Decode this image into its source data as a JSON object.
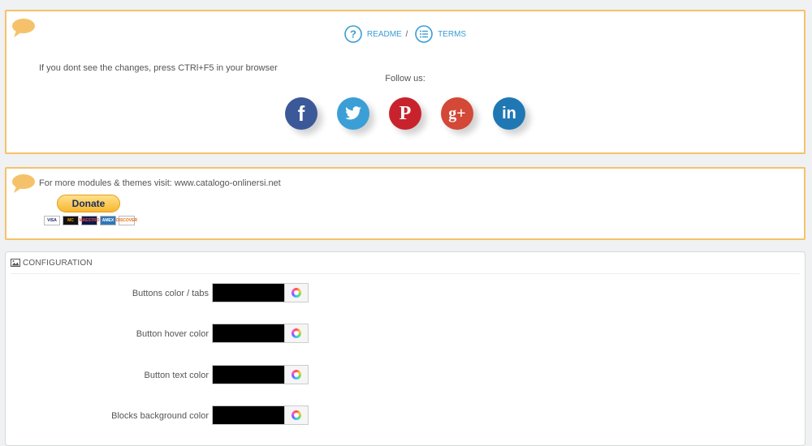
{
  "header_links": {
    "readme": "README",
    "separator": "/",
    "terms": "TERMS"
  },
  "notice": {
    "refresh_text": "If you dont see the changes, press CTRl+F5 in your browser",
    "follow_text": "Follow us:"
  },
  "social": [
    {
      "icon": "facebook-icon",
      "glyph": "f",
      "color": "#3b5998"
    },
    {
      "icon": "twitter-icon",
      "glyph": "🐦",
      "color": "#3b9fd6"
    },
    {
      "icon": "pinterest-icon",
      "glyph": "P",
      "color": "#c8232c"
    },
    {
      "icon": "google-plus-icon",
      "glyph": "g+",
      "color": "#d34836"
    },
    {
      "icon": "linkedin-icon",
      "glyph": "in",
      "color": "#1f78b4"
    }
  ],
  "promo": {
    "visit_text": "For more modules & themes visit: www.catalogo-onlinersi.net",
    "donate_label": "Donate",
    "cards": [
      "VISA",
      "MC",
      "MAESTRO",
      "AMEX",
      "DISCOVER"
    ]
  },
  "configuration": {
    "title": "CONFIGURATION",
    "fields": [
      {
        "label": "Buttons color / tabs",
        "value_color": "#000000"
      },
      {
        "label": "Button hover color",
        "value_color": "#000000"
      },
      {
        "label": "Button text color",
        "value_color": "#000000"
      },
      {
        "label": "Blocks background color",
        "value_color": "#000000"
      }
    ]
  },
  "colors": {
    "accent_border": "#f5c26b",
    "link": "#3a9dd4"
  }
}
